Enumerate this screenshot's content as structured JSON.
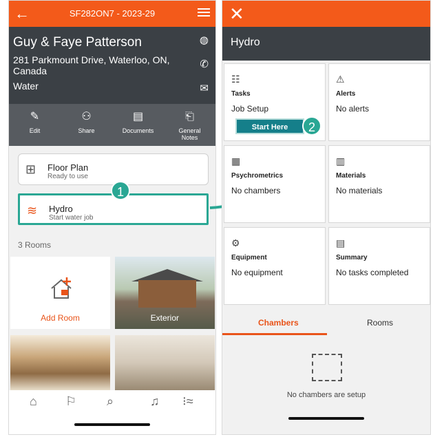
{
  "left": {
    "topbar": {
      "title": "SF282ON7 - 2023-29"
    },
    "job": {
      "name": "Guy & Faye Patterson",
      "address": "281 Parkmount Drive, Waterloo, ON, Canada",
      "type": "Water"
    },
    "actions": [
      {
        "label": "Edit",
        "icon": "pencil-icon"
      },
      {
        "label": "Share",
        "icon": "people-icon"
      },
      {
        "label": "Documents",
        "icon": "documents-icon"
      },
      {
        "label": "General Notes",
        "icon": "clipboard-icon"
      }
    ],
    "floor_plan": {
      "title": "Floor Plan",
      "subtitle": "Ready to use"
    },
    "hydro": {
      "title": "Hydro",
      "subtitle": "Start water job"
    },
    "rooms_label": "3 Rooms",
    "rooms": [
      {
        "label": "Add Room"
      },
      {
        "label": "Exterior"
      }
    ],
    "marker": "1"
  },
  "right": {
    "header": "Hydro",
    "modules": [
      {
        "name": "Tasks",
        "value": "Job Setup",
        "icon": "tasks-icon"
      },
      {
        "name": "Alerts",
        "value": "No alerts",
        "icon": "alert-icon"
      },
      {
        "name": "Psychrometrics",
        "value": "No chambers",
        "icon": "psychro-icon"
      },
      {
        "name": "Materials",
        "value": "No materials",
        "icon": "materials-icon"
      },
      {
        "name": "Equipment",
        "value": "No equipment",
        "icon": "equipment-icon"
      },
      {
        "name": "Summary",
        "value": "No tasks completed",
        "icon": "summary-icon"
      }
    ],
    "start_button": "Start Here",
    "marker": "2",
    "tabs": [
      "Chambers",
      "Rooms"
    ],
    "empty_message": "No chambers are setup"
  },
  "colors": {
    "brand": "#f35a1a",
    "header": "#3b4045",
    "highlight": "#2aa794"
  }
}
